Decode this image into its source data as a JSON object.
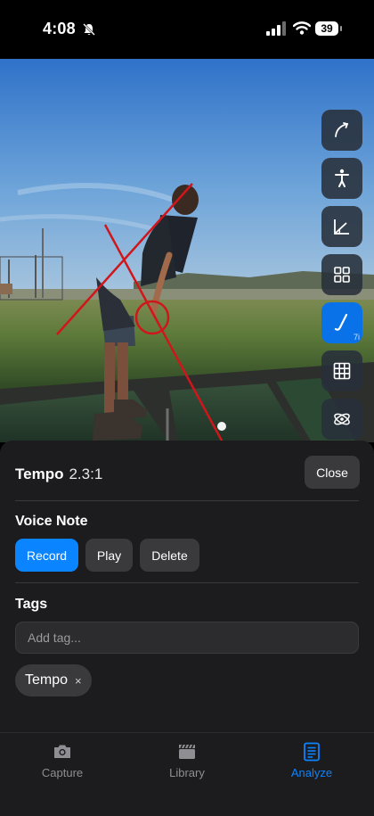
{
  "status_bar": {
    "time": "4:08",
    "battery": "39"
  },
  "video": {
    "tools": [
      {
        "name": "swing-path-icon",
        "active": false
      },
      {
        "name": "body-pose-icon",
        "active": false
      },
      {
        "name": "angle-icon",
        "active": false
      },
      {
        "name": "grid-4-icon",
        "active": false
      },
      {
        "name": "club-icon",
        "active": true,
        "badge": "7i"
      },
      {
        "name": "grid-9-icon",
        "active": false
      },
      {
        "name": "orbit-icon",
        "active": false
      }
    ]
  },
  "analysis_panel": {
    "tempo_label": "Tempo",
    "tempo_value": "2.3:1",
    "close_label": "Close",
    "voice_note_title": "Voice Note",
    "record_label": "Record",
    "play_label": "Play",
    "delete_label": "Delete",
    "tags_title": "Tags",
    "tag_placeholder": "Add tag...",
    "tags": [
      {
        "label": "Tempo",
        "remove": "×"
      }
    ]
  },
  "tab_bar": {
    "tabs": [
      {
        "label": "Capture",
        "icon": "camera-icon",
        "active": false
      },
      {
        "label": "Library",
        "icon": "clapperboard-icon",
        "active": false
      },
      {
        "label": "Analyze",
        "icon": "document-icon",
        "active": true
      }
    ]
  },
  "colors": {
    "accent": "#0a84ff",
    "overlay_line": "#d0161b",
    "panel": "#1c1c1e"
  }
}
